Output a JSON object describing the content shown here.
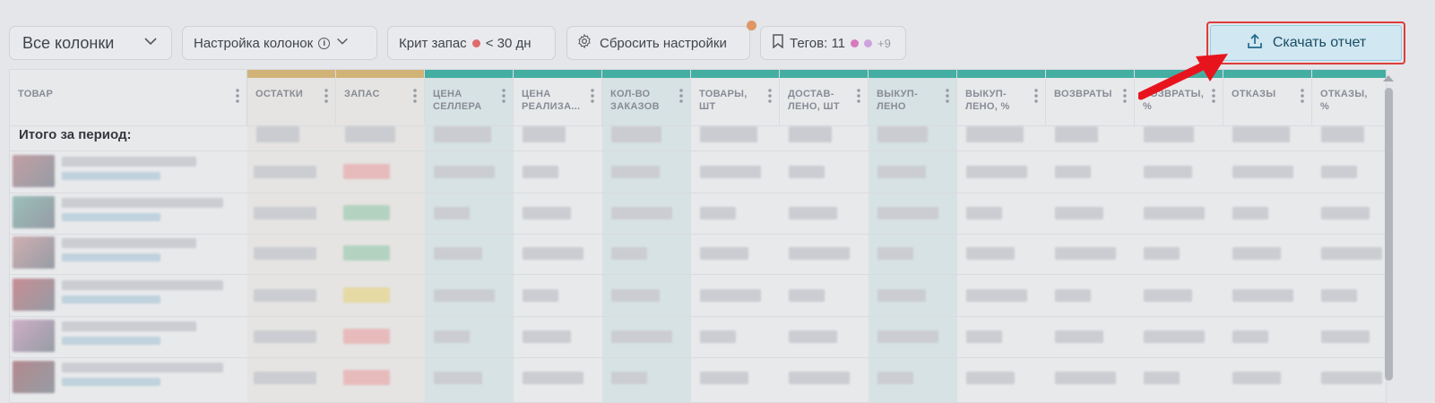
{
  "toolbar": {
    "columns_select": "Все колонки",
    "columns_settings": "Настройка колонок",
    "crit_stock": "Крит запас",
    "crit_threshold": "< 30 дн",
    "reset": "Сбросить настройки",
    "tags": "Тегов: 11",
    "tags_more": "+9",
    "download": "Скачать отчет"
  },
  "colors": {
    "accent_teal": "#42b3a6",
    "accent_tan": "#d9b978",
    "download_border": "#e53935",
    "download_bg": "#d9f1fb",
    "dot_red": "#e86b6b",
    "dot_pink": "#e07ac3",
    "dot_lavender": "#d7a6e8",
    "dot_orange": "#e89a63",
    "arrow": "#e8141d"
  },
  "icons": {
    "chevron": "chevron-down-icon",
    "info": "info-icon",
    "gear": "gear-icon",
    "bookmark": "bookmark-icon",
    "upload": "upload-icon"
  },
  "table": {
    "product_header": "ТОВАР",
    "total_label": "Итого за период:",
    "columns": [
      {
        "line1": "ОСТАТКИ",
        "line2": ""
      },
      {
        "line1": "ЗАПАС",
        "line2": ""
      },
      {
        "line1": "ЦЕНА",
        "line2": "СЕЛЛЕРА"
      },
      {
        "line1": "ЦЕНА",
        "line2": "РЕАЛИЗА..."
      },
      {
        "line1": "КОЛ-ВО",
        "line2": "ЗАКАЗОВ"
      },
      {
        "line1": "ТОВАРЫ,",
        "line2": "ШТ"
      },
      {
        "line1": "ДОСТАВ-",
        "line2": "ЛЕНО, ШТ"
      },
      {
        "line1": "ВЫКУП-",
        "line2": "ЛЕНО"
      },
      {
        "line1": "ВЫКУП-",
        "line2": "ЛЕНО, %"
      },
      {
        "line1": "ВОЗВРАТЫ",
        "line2": ""
      },
      {
        "line1": "ВОЗВРАТЫ,",
        "line2": "%"
      },
      {
        "line1": "ОТКАЗЫ",
        "line2": ""
      },
      {
        "line1": "ОТКАЗЫ,",
        "line2": "%"
      }
    ]
  }
}
